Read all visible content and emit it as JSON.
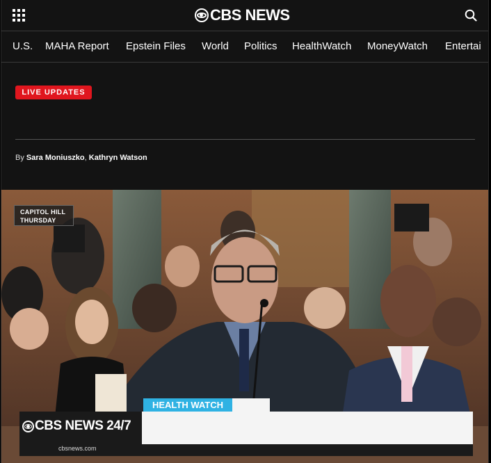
{
  "header": {
    "logo_text": "CBS NEWS",
    "menu_icon": "grid-menu-icon",
    "search_icon": "search-icon"
  },
  "nav": {
    "items": [
      "U.S.",
      "MAHA Report",
      "Epstein Files",
      "World",
      "Politics",
      "HealthWatch",
      "MoneyWatch",
      "Entertai"
    ]
  },
  "article": {
    "badge": "LIVE UPDATES",
    "byline_prefix": "By",
    "author_1": "Sara Moniuszko",
    "author_sep": ",",
    "author_2": "Kathryn Watson"
  },
  "video": {
    "location_line_1": "CAPITOL HILL",
    "location_line_2": "THURSDAY",
    "segment_tag": "HEALTH WATCH",
    "channel_logo": "CBS NEWS 24/7",
    "url": "cbsnews.com"
  },
  "colors": {
    "background": "#131313",
    "badge_red": "#e0161e",
    "health_watch_blue": "#2fb2e3"
  }
}
